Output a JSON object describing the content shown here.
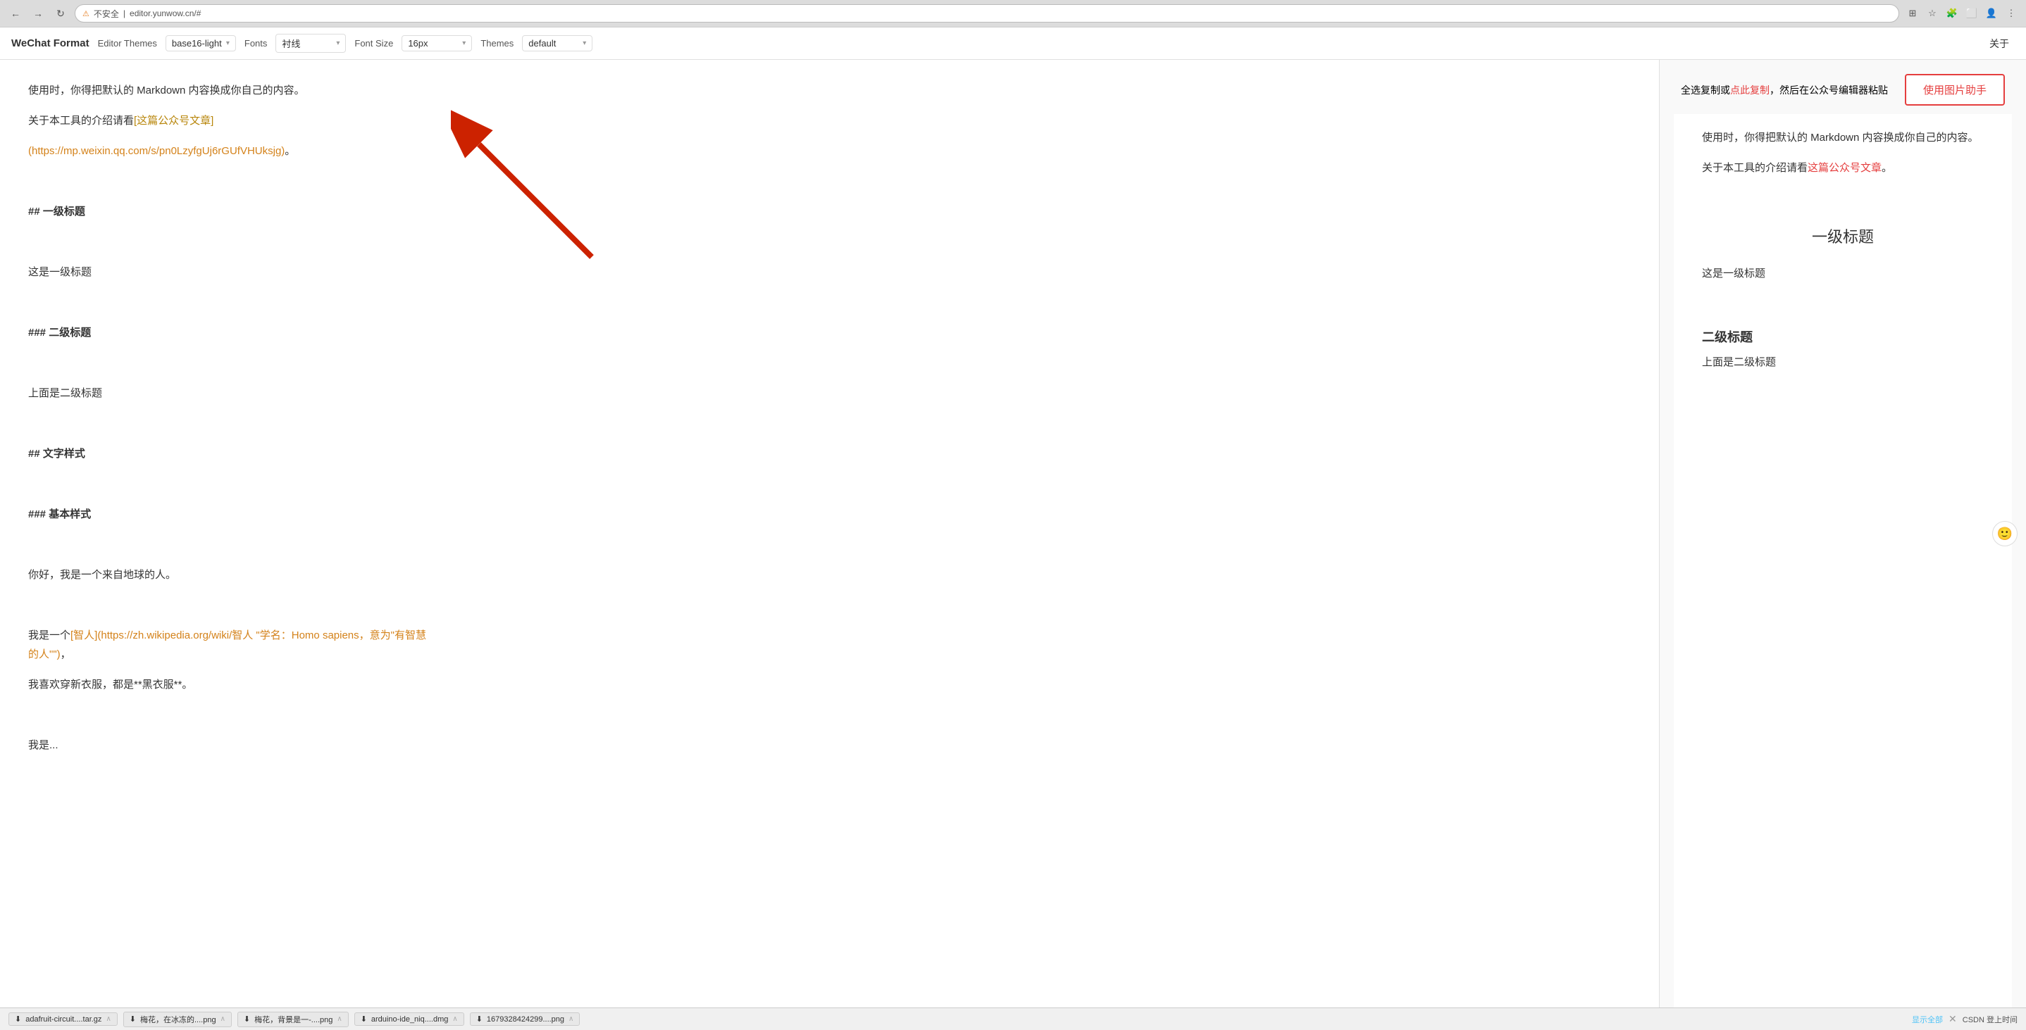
{
  "browser": {
    "url": "editor.yunwow.cn/#",
    "security_warning": "不安全",
    "nav": {
      "back": "←",
      "forward": "→",
      "refresh": "↻"
    }
  },
  "toolbar": {
    "logo": "WeChat Format",
    "editor_themes_label": "Editor Themes",
    "editor_themes_value": "base16-light",
    "fonts_label": "Fonts",
    "fonts_value": "衬线",
    "font_size_label": "Font Size",
    "font_size_value": "16px",
    "themes_label": "Themes",
    "themes_value": "default",
    "about_label": "关于"
  },
  "editor": {
    "lines": [
      "使用时，你得把默认的 Markdown 内容换成你自己的内容。",
      "关于本工具的介绍请看[这篇公众号文章]",
      "(https://mp.weixin.qq.com/s/pn0LzyfgUj6rGUfVHUksjg)。",
      "",
      "## 一级标题",
      "",
      "这是一级标题",
      "",
      "### 二级标题",
      "",
      "上面是二级标题",
      "",
      "## 文字样式",
      "",
      "### 基本样式",
      "",
      "你好，我是一个来自地球的人。",
      "",
      "我是一个[智人](https://zh.wikipedia.org/wiki/智人 \"学名：Homo sapiens，意为\"有智慧的人\"\")，",
      "我喜欢穿新衣服，都是**黑衣服**。",
      "",
      "我是..."
    ],
    "link1_text": "这篇公众号文章",
    "link2_text": "https://mp.weixin.qq.com/s/pn0LzyfgUj6rGUfVHUksjg",
    "link3_text": "智人",
    "link3_href": "https://zh.wikipedia.org/wiki/智人"
  },
  "preview": {
    "copy_text": "全选复制或",
    "copy_link_text": "点此复制",
    "copy_suffix": "，然后在公众号编辑器粘贴",
    "use_image_btn": "使用图片助手",
    "intro1": "使用时，你得把默认的 Markdown 内容换成你自己的内容。",
    "intro2_prefix": "关于本工具的介绍请看",
    "intro2_link": "这篇公众号文章",
    "intro2_suffix": "。",
    "h1": "一级标题",
    "h1_text": "这是一级标题",
    "h2": "二级标题",
    "h2_text": "上面是二级标题"
  },
  "status_bar": {
    "items": [
      {
        "name": "adafruit-circuit....tar.gz"
      },
      {
        "name": "梅花，在冰冻的....png"
      },
      {
        "name": "梅花，背景是一-....png"
      },
      {
        "name": "arduino-ide_niq....dmg"
      },
      {
        "name": "1679328424299....png"
      }
    ],
    "show_all": "显示全部",
    "chevron_label": "^",
    "csdn_text": "CSDN 登上时间"
  }
}
